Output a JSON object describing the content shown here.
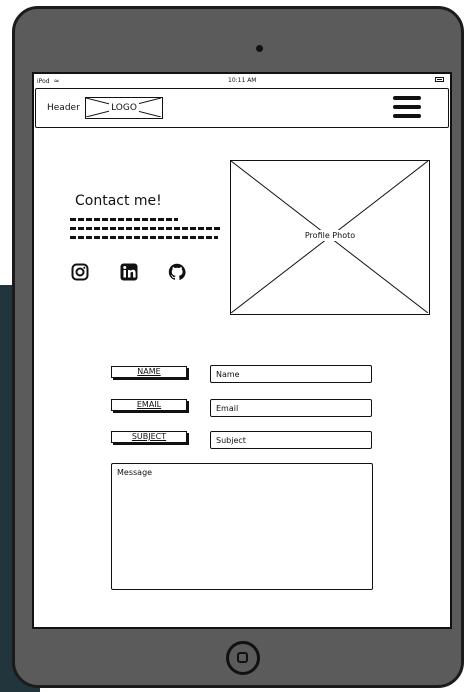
{
  "statusbar": {
    "carrier": "iPod",
    "time": "10:11 AM"
  },
  "header": {
    "label": "Header",
    "logo_text": "LOGO"
  },
  "contact": {
    "title": "Contact me!"
  },
  "photo": {
    "label": "Profile Photo"
  },
  "form": {
    "name_label": "NAME",
    "email_label": "EMAIL",
    "subject_label": "SUBJECT",
    "name_placeholder": "Name",
    "email_placeholder": "Email",
    "subject_placeholder": "Subject",
    "message_placeholder": "Message"
  },
  "icons": {
    "social": [
      "instagram-icon",
      "linkedin-icon",
      "github-icon"
    ],
    "menu": "hamburger-menu-icon"
  }
}
